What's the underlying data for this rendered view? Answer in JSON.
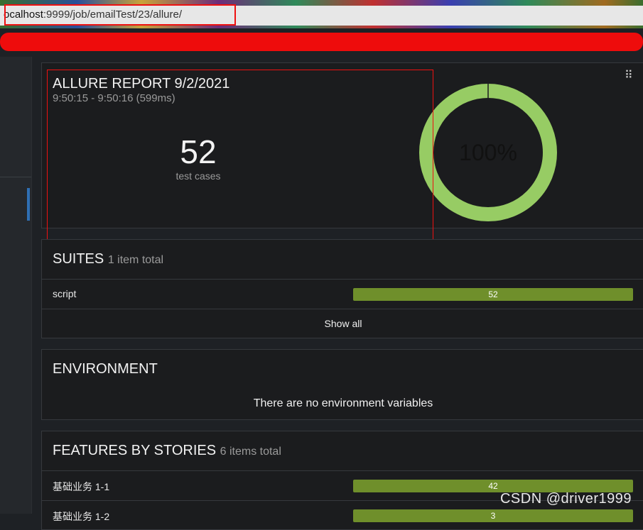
{
  "browser": {
    "url_host": "ocalhost",
    "url_rest": ":9999/job/emailTest/23/allure/"
  },
  "summary": {
    "title": "ALLURE REPORT 9/2/2021",
    "time_range": "9:50:15 - 9:50:16 (599ms)",
    "test_count": "52",
    "test_count_label": "test cases",
    "pass_percent": "100%",
    "pass_fraction": 1.0,
    "menu_icon": "grid-dots-icon"
  },
  "suites": {
    "title": "SUITES",
    "subtitle": "1 item total",
    "items": [
      {
        "name": "script",
        "count": "52"
      }
    ],
    "show_all": "Show all"
  },
  "environment": {
    "title": "ENVIRONMENT",
    "message": "There are no environment variables"
  },
  "features": {
    "title": "FEATURES BY STORIES",
    "subtitle": "6 items total",
    "items": [
      {
        "name": "基础业务 1-1",
        "count": "42"
      },
      {
        "name": "基础业务 1-2",
        "count": "3"
      }
    ]
  },
  "watermark": "CSDN @driver1999",
  "colors": {
    "passed": "#97cc64",
    "bar_fill": "#6f8f2b",
    "annotation_red": "#e11111"
  }
}
